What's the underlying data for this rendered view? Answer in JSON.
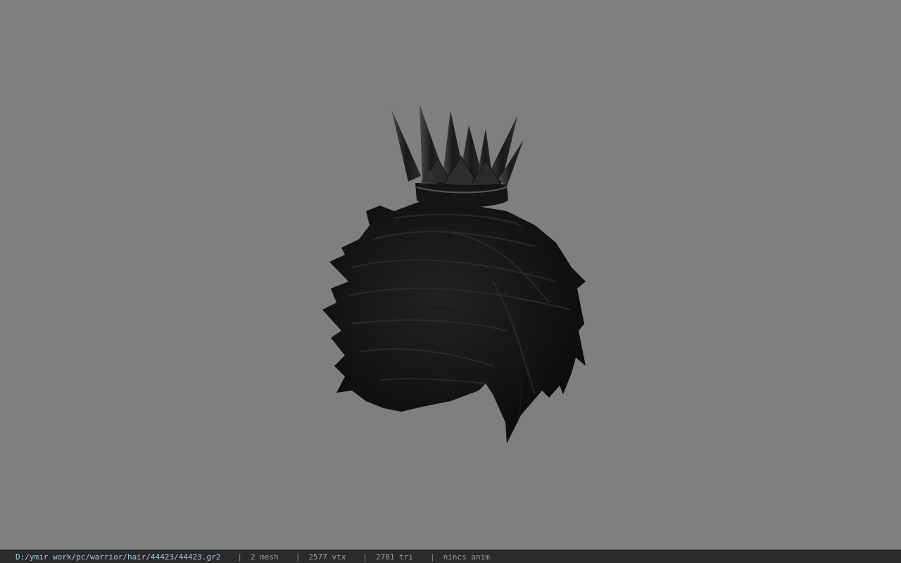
{
  "viewport": {
    "background": "#7f7f7f",
    "model_name": "hair-with-crown-model"
  },
  "statusbar": {
    "path": "D:/ymir work/pc/warrior/hair/44423/44423.gr2",
    "separator": "|",
    "mesh": "2 mesh",
    "vtx": "2577 vtx",
    "tri": "2781 tri",
    "anim": "nincs anim"
  }
}
